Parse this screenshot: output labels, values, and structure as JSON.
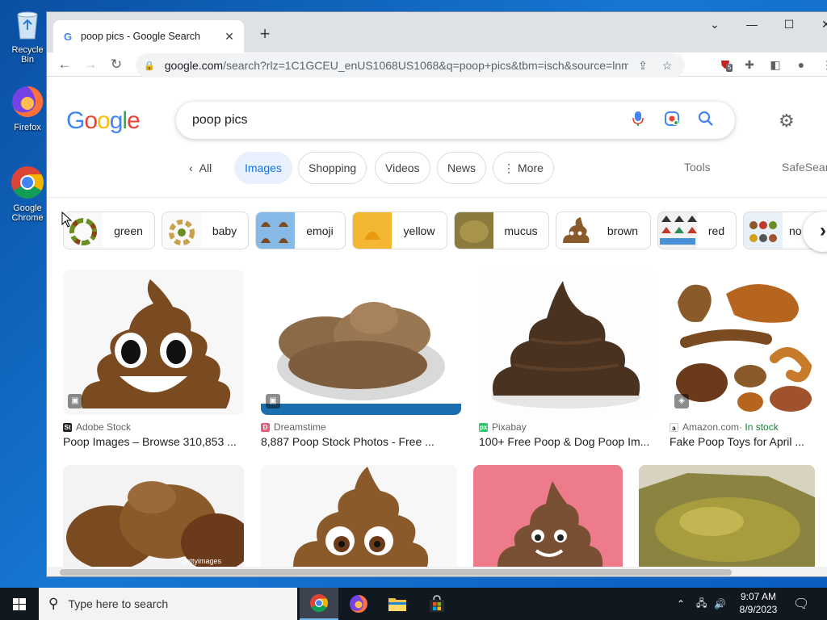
{
  "desktop": {
    "icons": [
      {
        "label": "Recycle Bin",
        "icon": "recycle-bin-icon"
      },
      {
        "label": "Firefox",
        "icon": "firefox-icon"
      },
      {
        "label": "Google Chrome",
        "icon": "chrome-icon"
      }
    ]
  },
  "browser": {
    "tab_title": "poop pics - Google Search",
    "new_tab": "+",
    "url_main": "google.com",
    "url_rest": "/search?rlz=1C1GCEU_enUS1068US1068&q=poop+pics&tbm=isch&source=lnms&...",
    "ext_badge": "5"
  },
  "google": {
    "logo": "Google",
    "query": "poop pics",
    "filters": [
      {
        "label": "All",
        "active": false
      },
      {
        "label": "Images",
        "active": true
      },
      {
        "label": "Shopping",
        "active": false
      },
      {
        "label": "Videos",
        "active": false
      },
      {
        "label": "News",
        "active": false
      },
      {
        "label": "More",
        "active": false
      }
    ],
    "tools": "Tools",
    "safesearch": "SafeSearch",
    "related": [
      "green",
      "baby",
      "emoji",
      "yellow",
      "mucus",
      "brown",
      "red",
      "no"
    ],
    "results": [
      {
        "source": "Adobe Stock",
        "title": "Poop Images – Browse 310,853 ...",
        "stock": ""
      },
      {
        "source": "Dreamstime",
        "title": "8,887 Poop Stock Photos - Free ...",
        "stock": ""
      },
      {
        "source": "Pixabay",
        "title": "100+ Free Poop & Dog Poop Im...",
        "stock": ""
      },
      {
        "source": "Amazon.com",
        "title": "Fake Poop Toys for April ...",
        "stock": " · In stock"
      }
    ],
    "watermark": "gettyimages"
  },
  "taskbar": {
    "search_placeholder": "Type here to search",
    "time": "9:07 AM",
    "date": "8/9/2023"
  },
  "colors": {
    "google_blue": "#4285f4",
    "google_red": "#ea4335",
    "google_yellow": "#fbbc05",
    "google_green": "#34a853",
    "poop_brown": "#7a4a21"
  }
}
